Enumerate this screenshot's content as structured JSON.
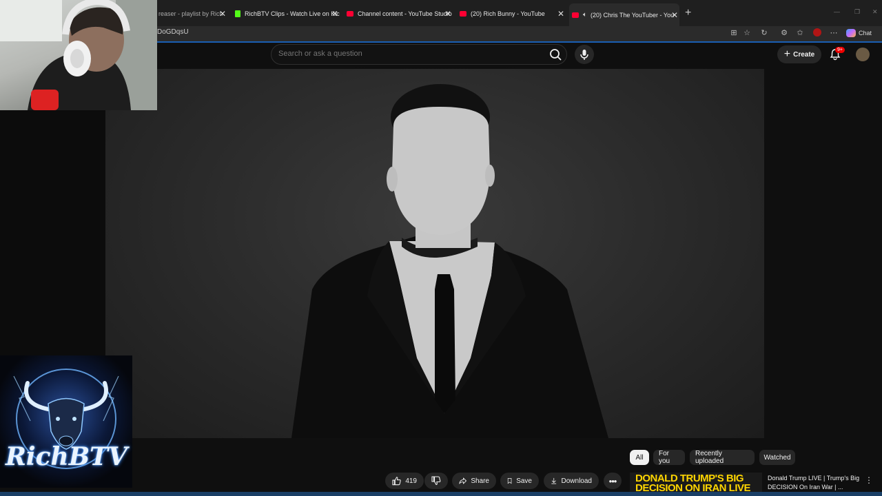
{
  "browser": {
    "tabs": [
      {
        "label": "reaser - playlist by Rich",
        "favicon": "music"
      },
      {
        "label": "RichBTV Clips - Watch Live on Kick",
        "favicon": "kick"
      },
      {
        "label": "Channel content - YouTube Studio",
        "favicon": "youtube"
      },
      {
        "label": "(20) Rich Bunny - YouTube",
        "favicon": "youtube"
      },
      {
        "label": "(20) Chris The YouTuber - You",
        "favicon": "youtube"
      }
    ],
    "url": "DoGDqsU",
    "chat_label": "Chat"
  },
  "youtube": {
    "search_placeholder": "Search or ask a question",
    "create_label": "Create",
    "notifications_badge": "9+"
  },
  "video": {
    "likes": "419",
    "actions": {
      "share": "Share",
      "save": "Save",
      "download": "Download"
    }
  },
  "filters": [
    "All",
    "For you",
    "Recently uploaded",
    "Watched"
  ],
  "recommendation": {
    "thumb_text": "DONALD TRUMP'S BIG DECISION ON IRAN LIVE",
    "title": "Donald Trump LIVE | Trump's Big DECISION On Iran War | ..."
  },
  "overlay": {
    "logo_text": "RichBTV"
  },
  "colors": {
    "accent_blue": "#1a5fb4",
    "youtube_red": "#ff0033",
    "thumb_yellow": "#ffd500"
  }
}
